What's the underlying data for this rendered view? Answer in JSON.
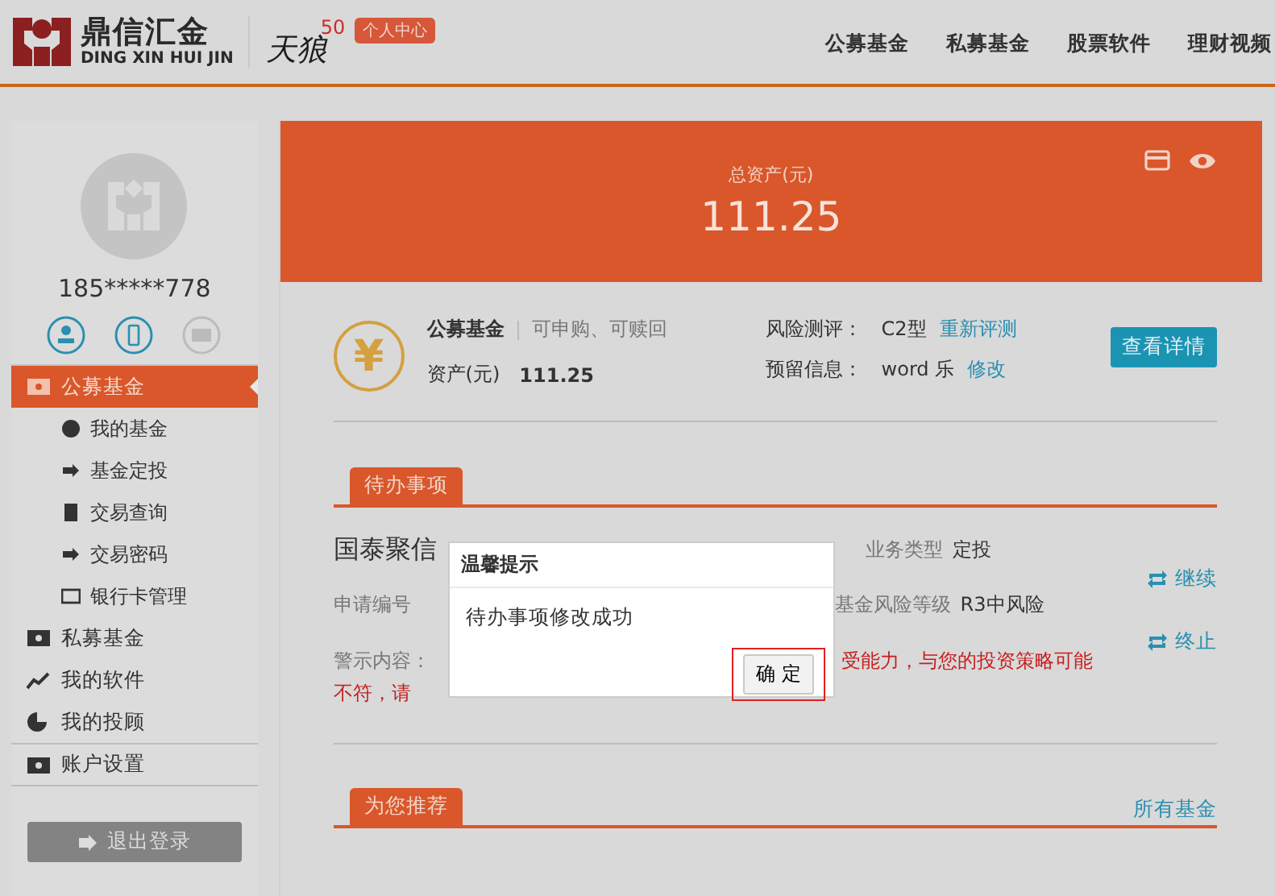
{
  "header": {
    "logo_name": "鼎信汇金",
    "logo_pinyin": "DING XIN HUI JIN",
    "brand": "天狼",
    "brand_sup": "50",
    "badge": "个人中心",
    "nav": [
      {
        "label": "公募基金"
      },
      {
        "label": "私募基金"
      },
      {
        "label": "股票软件"
      },
      {
        "label": "理财视频"
      }
    ]
  },
  "sidebar": {
    "phone": "185*****778",
    "contacts": [
      {
        "verified": true
      },
      {
        "verified": true
      },
      {
        "verified": false
      }
    ],
    "items": [
      {
        "label": "公募基金",
        "selected": true,
        "children": [
          {
            "label": "我的基金"
          },
          {
            "label": "基金定投"
          },
          {
            "label": "交易查询"
          },
          {
            "label": "交易密码"
          },
          {
            "label": "银行卡管理"
          }
        ]
      },
      {
        "label": "私募基金",
        "selected": false
      },
      {
        "label": "我的软件",
        "selected": false
      },
      {
        "label": "我的投顾",
        "selected": false
      },
      {
        "label": "账户设置",
        "selected": false
      }
    ],
    "logout": "退出登录"
  },
  "summary": {
    "label": "总资产(元)",
    "value": "111.25"
  },
  "fund": {
    "symbol": "¥",
    "title": "公募基金",
    "status": "可申购、可赎回",
    "asset_label": "资产(元)",
    "asset_value": "111.25",
    "risk_label": "风险测评：",
    "risk_value": "C2型",
    "risk_link": "重新评测",
    "note_label": "预留信息：",
    "note_value": "word 乐",
    "note_link": "修改",
    "detail_button": "查看详情"
  },
  "pending": {
    "tab": "待办事项",
    "fund_name": "国泰聚信",
    "type_label": "业务类型",
    "type_value": "定投",
    "apply_label": "申请编号",
    "risk_level_label": "基金风险等级",
    "risk_level_value": "R3中风险",
    "warning_label": "警示内容：",
    "warning_line1": "受能力，与您的投资策略可能",
    "warning_line2": "不符，请",
    "actions": [
      {
        "label": "继续"
      },
      {
        "label": "终止"
      }
    ]
  },
  "recommend": {
    "tab": "为您推荐",
    "link": "所有基金"
  },
  "dialog": {
    "title": "温馨提示",
    "message": "待办事项修改成功",
    "button": "确 定",
    "button_highlighted": true
  }
}
